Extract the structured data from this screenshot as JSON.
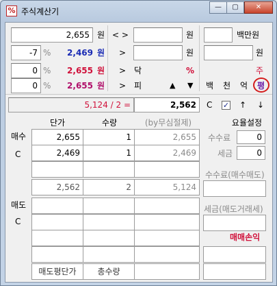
{
  "window": {
    "title": "주식계산기",
    "icon": "percent-icon",
    "min_label": "—",
    "max_label": "▢",
    "close_label": "✕"
  },
  "top": {
    "left": {
      "price": "2,655",
      "won1": "원",
      "pct1": "-7",
      "pct_sym1": "%",
      "val1": "2,469",
      "won2": "원",
      "pct2": "0",
      "pct_sym2": "%",
      "val2": "2,655",
      "won3": "원",
      "pct3": "0",
      "pct_sym3": "%",
      "val3": "2,655",
      "won4": "원"
    },
    "mid": {
      "arrows1": "< >",
      "arrow2": ">",
      "arrow3": ">",
      "arrow4": ">",
      "won5": "원",
      "won6": "원",
      "label_dak": "닥",
      "label_pct": "%",
      "label_pi": "피",
      "up": "▲",
      "down": "▼"
    },
    "right": {
      "unit_baekman": "백만원",
      "won7": "원",
      "ju": "주",
      "baek": "백",
      "cheon": "천",
      "eok": "억",
      "pyeong": "평"
    }
  },
  "calc": {
    "expr": "5,124 / 2 =",
    "result": "2,562",
    "c_label": "C",
    "check": "✓",
    "up": "↑",
    "down": "↓"
  },
  "table": {
    "headers": [
      "단가",
      "수량",
      "(by무심절제)"
    ],
    "fee_header": "요율설정",
    "buy_label": "매수",
    "buy_c": "C",
    "sell_label": "매도",
    "sell_c": "C",
    "buy_rows": [
      [
        "2,655",
        "1",
        "2,655"
      ],
      [
        "2,469",
        "1",
        "2,469"
      ],
      [
        "",
        "",
        ""
      ]
    ],
    "buy_sum": [
      "2,562",
      "2",
      "5,124"
    ],
    "fee_label": "수수료",
    "fee_value": "0",
    "tax_label": "세금",
    "tax_value": "0",
    "fee_buysell": "수수료(매수매도)",
    "tax_sell": "세금(매도거래세)",
    "profit_label": "매매손익",
    "sell_footer": [
      "매도평단가",
      "총수량",
      ""
    ]
  }
}
